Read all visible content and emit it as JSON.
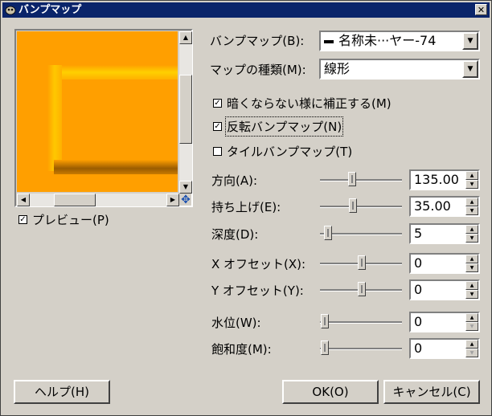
{
  "window": {
    "title": "バンプマップ",
    "close_glyph": "✕"
  },
  "preview": {
    "checkbox_label": "プレビュー(P)",
    "checked": true
  },
  "bumpmap": {
    "label": "バンプマップ(B):",
    "value": "名称未···ヤー-74"
  },
  "map_type": {
    "label": "マップの種類(M):",
    "value": "線形"
  },
  "options": [
    {
      "label": "暗くならない様に補正する(M)",
      "checked": true
    },
    {
      "label": "反転バンプマップ(N)",
      "checked": true
    },
    {
      "label": "タイルバンプマップ(T)",
      "checked": false
    }
  ],
  "params": [
    {
      "label": "方向(A):",
      "value": "135.00",
      "fraction": 0.38
    },
    {
      "label": "持ち上げ(E):",
      "value": "35.00",
      "fraction": 0.39
    },
    {
      "label": "深度(D):",
      "value": "5",
      "fraction": 0.08
    },
    {
      "label": "X オフセット(X):",
      "value": "0",
      "fraction": 0.5
    },
    {
      "label": "Y オフセット(Y):",
      "value": "0",
      "fraction": 0.5
    },
    {
      "label": "水位(W):",
      "value": "0",
      "fraction": 0.0
    },
    {
      "label": "飽和度(M):",
      "value": "0",
      "fraction": 0.0
    }
  ],
  "buttons": {
    "help": "ヘルプ(H)",
    "ok": "OK(O)",
    "cancel": "キャンセル(C)"
  },
  "colors": {
    "titlebar": "#0a246a",
    "preview_fill": "#ff9f00",
    "dialog_bg": "#d4d0c8"
  }
}
